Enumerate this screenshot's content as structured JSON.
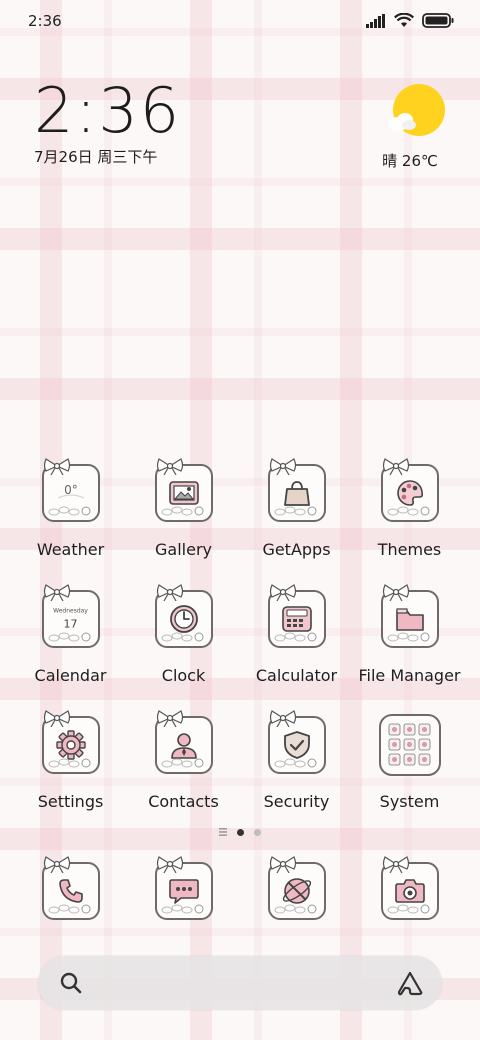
{
  "status_bar": {
    "time": "2:36",
    "icons": [
      "signal-icon",
      "wifi-icon",
      "battery-icon"
    ]
  },
  "clock_widget": {
    "time": "2:36",
    "date": "7月26日 周三下午"
  },
  "weather_widget": {
    "condition_temp": "晴 26℃",
    "icon": "sun-cloud-icon",
    "sun_color": "#ffd21f"
  },
  "apps": [
    {
      "label": "Weather",
      "icon": "weather-icon"
    },
    {
      "label": "Gallery",
      "icon": "gallery-icon"
    },
    {
      "label": "GetApps",
      "icon": "shopping-bag-icon"
    },
    {
      "label": "Themes",
      "icon": "palette-icon"
    },
    {
      "label": "Calendar",
      "icon": "calendar-icon",
      "day_name": "Wednesday",
      "day_num": "17"
    },
    {
      "label": "Clock",
      "icon": "clock-icon"
    },
    {
      "label": "Calculator",
      "icon": "calculator-icon"
    },
    {
      "label": "File Manager",
      "icon": "folder-icon"
    },
    {
      "label": "Settings",
      "icon": "gear-icon"
    },
    {
      "label": "Contacts",
      "icon": "contact-icon"
    },
    {
      "label": "Security",
      "icon": "shield-icon"
    },
    {
      "label": "System",
      "icon": "folder-grid-icon"
    }
  ],
  "dock": [
    {
      "name": "phone",
      "icon": "phone-icon"
    },
    {
      "name": "messages",
      "icon": "message-icon"
    },
    {
      "name": "browser",
      "icon": "browser-icon"
    },
    {
      "name": "camera",
      "icon": "camera-icon"
    }
  ],
  "page_indicator": {
    "pages": 2,
    "current": 1
  },
  "search_bar": {
    "left_icon": "search-icon",
    "right_icon": "assistant-icon"
  },
  "colors": {
    "accent_pink": "#f2b8c3",
    "icon_outline": "#6f6a6a",
    "dark": "#333333"
  }
}
